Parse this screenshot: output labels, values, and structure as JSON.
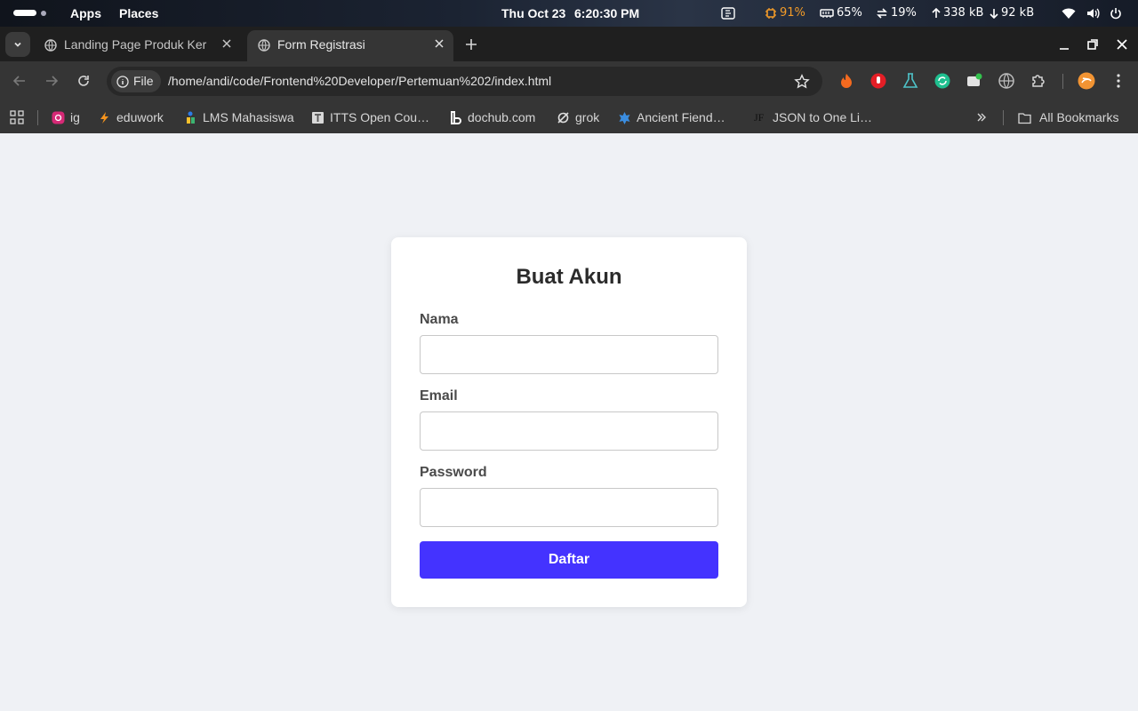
{
  "topbar": {
    "apps": "Apps",
    "places": "Places",
    "date": "Thu Oct 23",
    "time": "6:20:30 PM",
    "cpu": "91%",
    "mem": "65%",
    "swap": "19%",
    "upload": "338 kB",
    "download": "92 kB",
    "accent_warning": "#f39b28"
  },
  "tabs": [
    {
      "title": "Landing Page Produk Ker",
      "icon": "globe-icon",
      "active": false
    },
    {
      "title": "Form Registrasi",
      "icon": "globe-icon",
      "active": true
    }
  ],
  "toolbar": {
    "chip_label": "File",
    "url": "/home/andi/code/Frontend%20Developer/Pertemuan%202/index.html"
  },
  "bookmarks": [
    {
      "label": "ig",
      "icon": "instagram-icon"
    },
    {
      "label": "eduwork",
      "icon": "eduwork-icon"
    },
    {
      "label": "LMS Mahasiswa",
      "icon": "lms-icon"
    },
    {
      "label": "ITTS Open Cou…",
      "icon": "itts-icon"
    },
    {
      "label": "dochub.com",
      "icon": "dochub-icon"
    },
    {
      "label": "grok",
      "icon": "grok-icon"
    },
    {
      "label": "Ancient Fiend…",
      "icon": "ancient-fiend-icon"
    },
    {
      "label": "JSON to One Li…",
      "icon": "json-icon"
    },
    {
      "label": "All Bookmarks",
      "icon": "folder-icon"
    }
  ],
  "form": {
    "title": "Buat Akun",
    "fields": [
      {
        "label": "Nama",
        "value": "",
        "placeholder": ""
      },
      {
        "label": "Email",
        "value": "",
        "placeholder": ""
      },
      {
        "label": "Password",
        "value": "",
        "placeholder": ""
      }
    ],
    "submit_label": "Daftar",
    "accent": "#4433ff"
  }
}
